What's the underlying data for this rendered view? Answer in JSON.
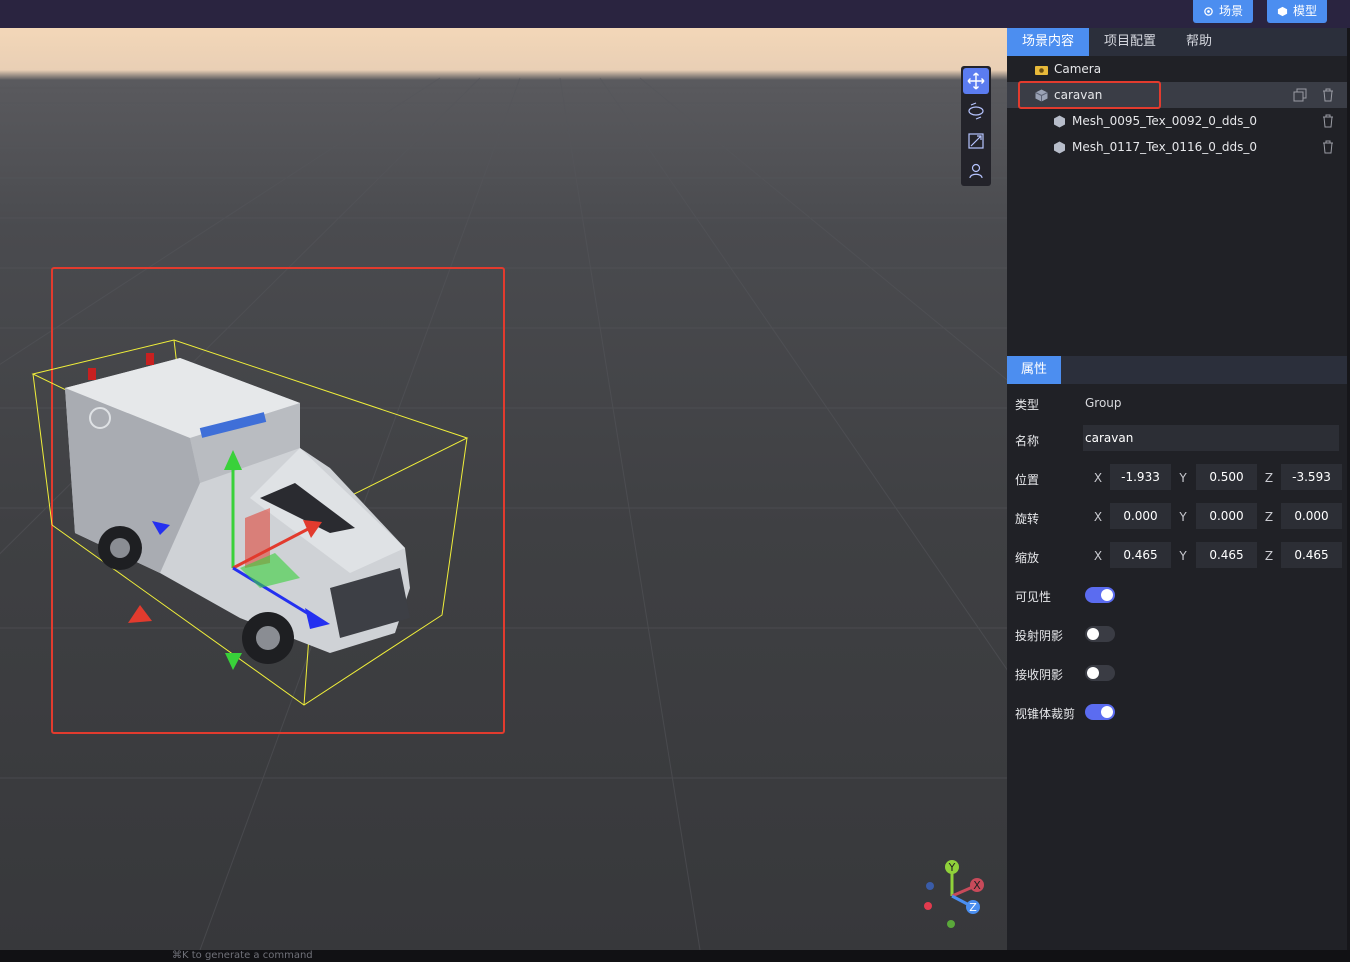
{
  "topbar": {
    "buttons": [
      {
        "label": "场景",
        "icon": "scene-icon"
      },
      {
        "label": "模型",
        "icon": "cube-icon"
      }
    ]
  },
  "viewport": {
    "tools": [
      "move-icon",
      "rotate-icon",
      "scale-icon",
      "user-icon"
    ],
    "gizmo_labels": {
      "y": "Y",
      "x": "X",
      "z": "Z"
    }
  },
  "panel": {
    "tabs": [
      "场景内容",
      "项目配置",
      "帮助"
    ],
    "tree": [
      {
        "label": "Camera",
        "icon": "camera-icon"
      },
      {
        "label": "caravan",
        "icon": "group-icon"
      },
      {
        "label": "Mesh_0095_Tex_0092_0_dds_0",
        "icon": "mesh-icon"
      },
      {
        "label": "Mesh_0117_Tex_0116_0_dds_0",
        "icon": "mesh-icon"
      }
    ],
    "props_tab": "属性",
    "props": {
      "type_label": "类型",
      "type_value": "Group",
      "name_label": "名称",
      "name_value": "caravan",
      "position_label": "位置",
      "rotation_label": "旋转",
      "scale_label": "缩放",
      "axis_x": "X",
      "axis_y": "Y",
      "axis_z": "Z",
      "position": [
        "-1.933",
        "0.500",
        "-3.593"
      ],
      "rotation": [
        "0.000",
        "0.000",
        "0.000"
      ],
      "scale": [
        "0.465",
        "0.465",
        "0.465"
      ],
      "visible_label": "可见性",
      "visible": true,
      "cast_shadow_label": "投射阴影",
      "cast_shadow": false,
      "receive_shadow_label": "接收阴影",
      "receive_shadow": false,
      "frustum_label": "视锥体裁剪",
      "frustum": true
    }
  },
  "bottombar": {
    "command_hint": "⌘K to generate a command"
  },
  "colors": {
    "accent": "#4c8ef0",
    "toggle_on": "#5b6cf0",
    "selection_box": "#e23b2e",
    "bounding_box": "#f0ef3a"
  }
}
